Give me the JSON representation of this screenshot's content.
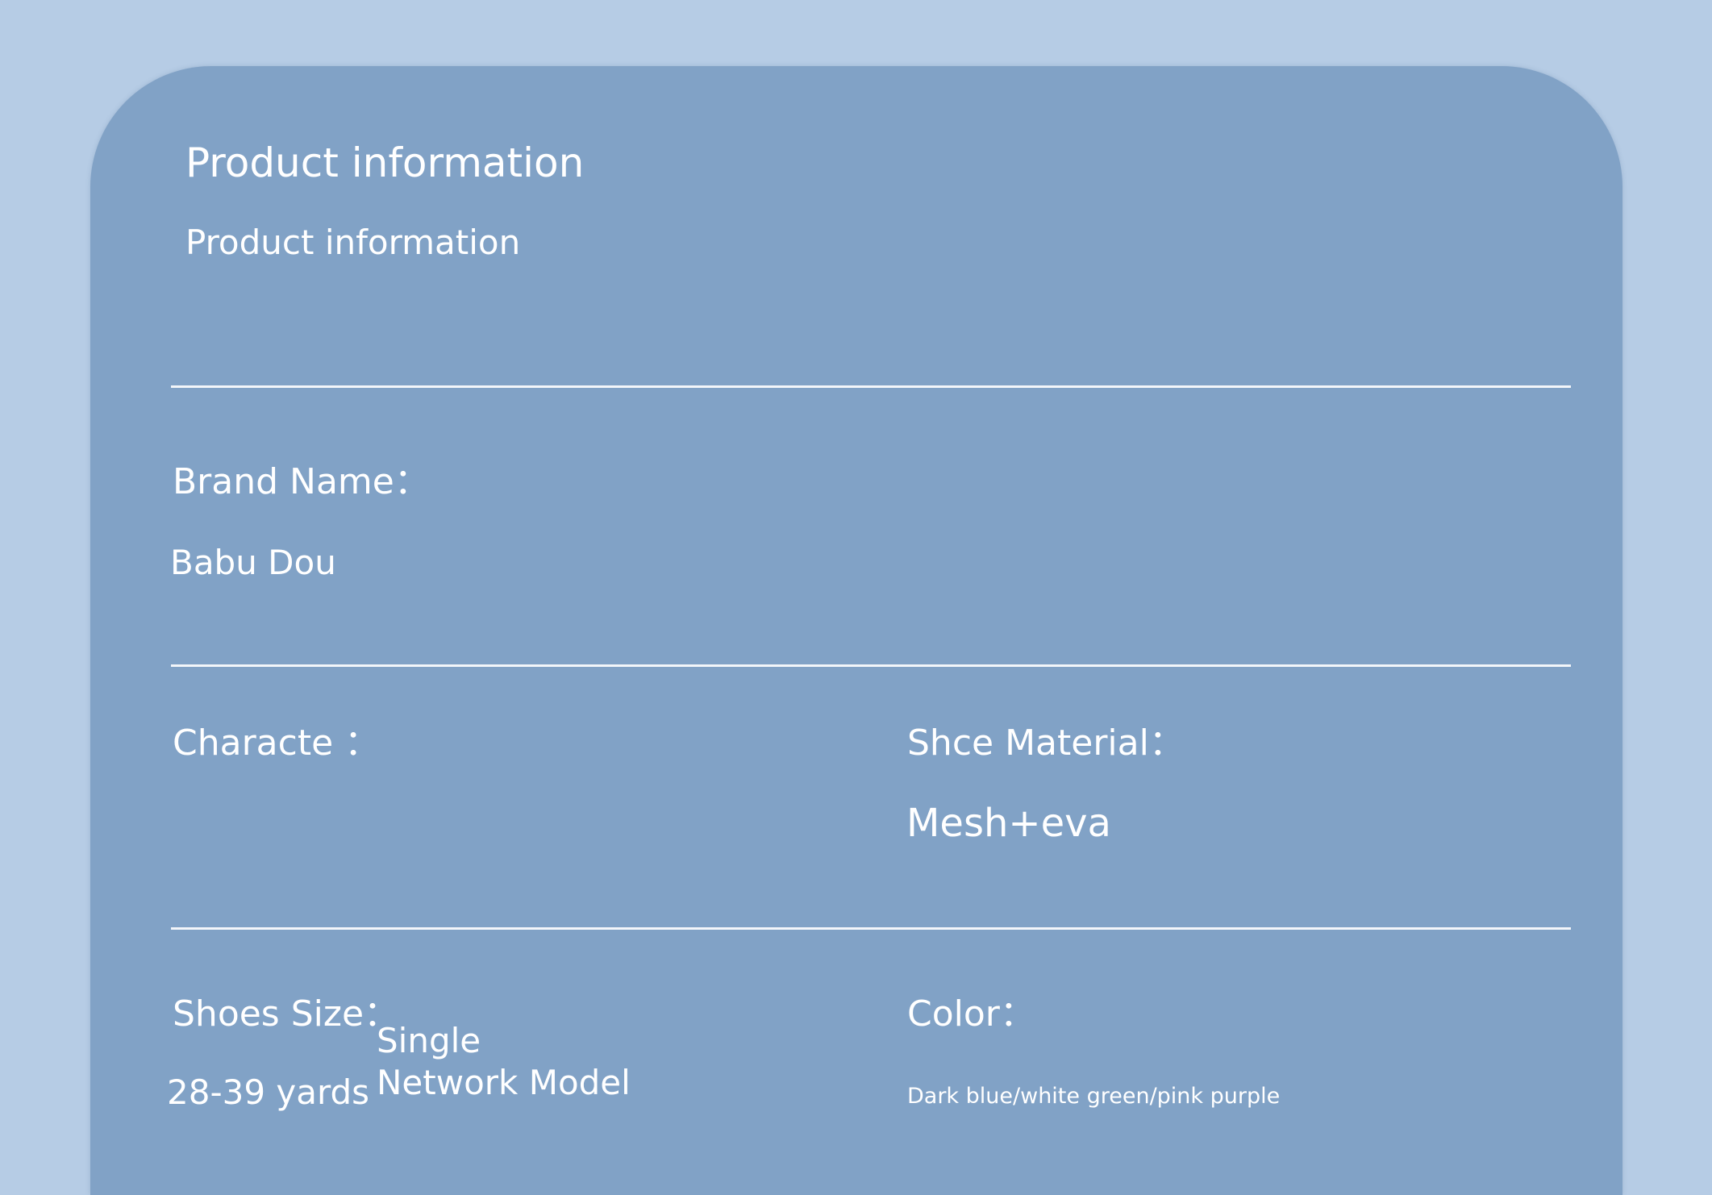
{
  "header": {
    "title": "Product information",
    "subtitle": "Product information"
  },
  "fields": {
    "brand_name": {
      "label": "Brand Name：",
      "value": "Babu Dou"
    },
    "characte": {
      "label": "Characte ："
    },
    "shoe_material": {
      "label": "Shce Material：",
      "value": "Mesh+eva"
    },
    "shoes_size": {
      "label": "Shoes Size：",
      "value": "28-39 yards",
      "note_line1": "Single",
      "note_line2": "Network Model"
    },
    "color": {
      "label": "Color：",
      "value": "Dark blue/white green/pink purple"
    }
  },
  "colors": {
    "background": "#b6cce5",
    "card": "#81a2c6",
    "text": "#ffffff",
    "divider": "#f3f6fa"
  }
}
